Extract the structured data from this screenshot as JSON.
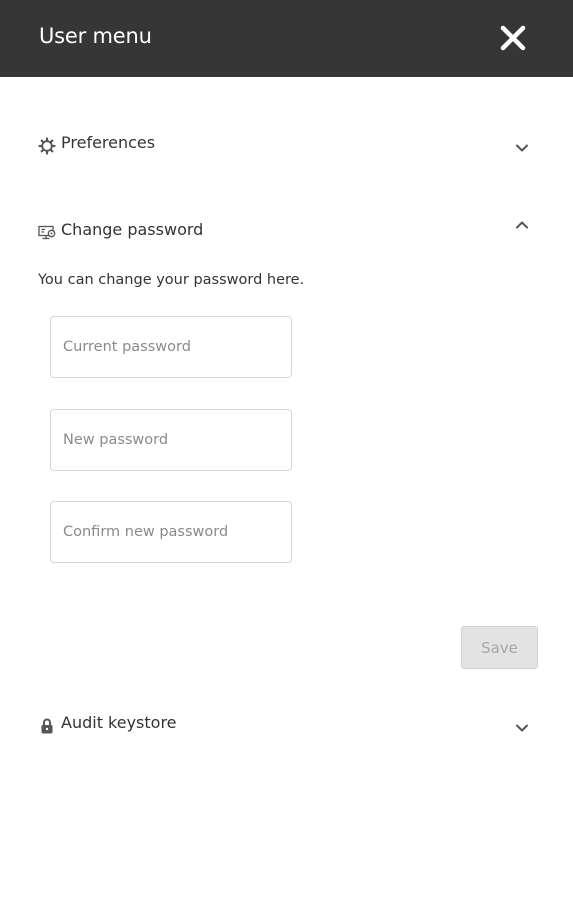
{
  "header": {
    "title": "User menu",
    "close_icon": "close-icon"
  },
  "sections": {
    "preferences": {
      "label": "Preferences",
      "icon": "gear-icon",
      "expanded": false
    },
    "change_password": {
      "label": "Change password",
      "icon": "password-icon",
      "expanded": true,
      "description": "You can change your password here.",
      "fields": {
        "current": {
          "placeholder": "Current password",
          "value": ""
        },
        "new": {
          "placeholder": "New password",
          "value": ""
        },
        "confirm": {
          "placeholder": "Confirm new password",
          "value": ""
        }
      },
      "save_label": "Save",
      "save_enabled": false
    },
    "audit_keystore": {
      "label": "Audit keystore",
      "icon": "lock-icon",
      "expanded": false
    }
  },
  "colors": {
    "header_bg": "#363636",
    "header_text": "#ffffff",
    "text": "#333333",
    "placeholder": "#8a8a8a",
    "border": "#d6d6d6",
    "disabled_button_bg": "#e3e3e3",
    "disabled_button_text": "#a6a6a6"
  }
}
